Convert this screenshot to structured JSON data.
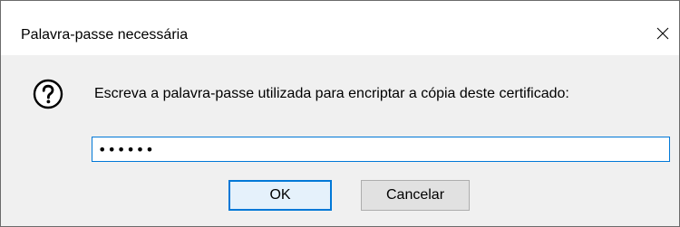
{
  "window": {
    "title": "Palavra-passe necessária",
    "close_icon": "close-icon"
  },
  "dialog": {
    "icon": "question-icon",
    "message": "Escreva a palavra-passe utilizada para encriptar a cópia deste certificado:",
    "password_value": "••••••"
  },
  "buttons": {
    "ok_label": "OK",
    "cancel_label": "Cancelar"
  },
  "colors": {
    "accent": "#0078d7",
    "dialog_background": "#f0f0f0",
    "titlebar_background": "#ffffff"
  }
}
